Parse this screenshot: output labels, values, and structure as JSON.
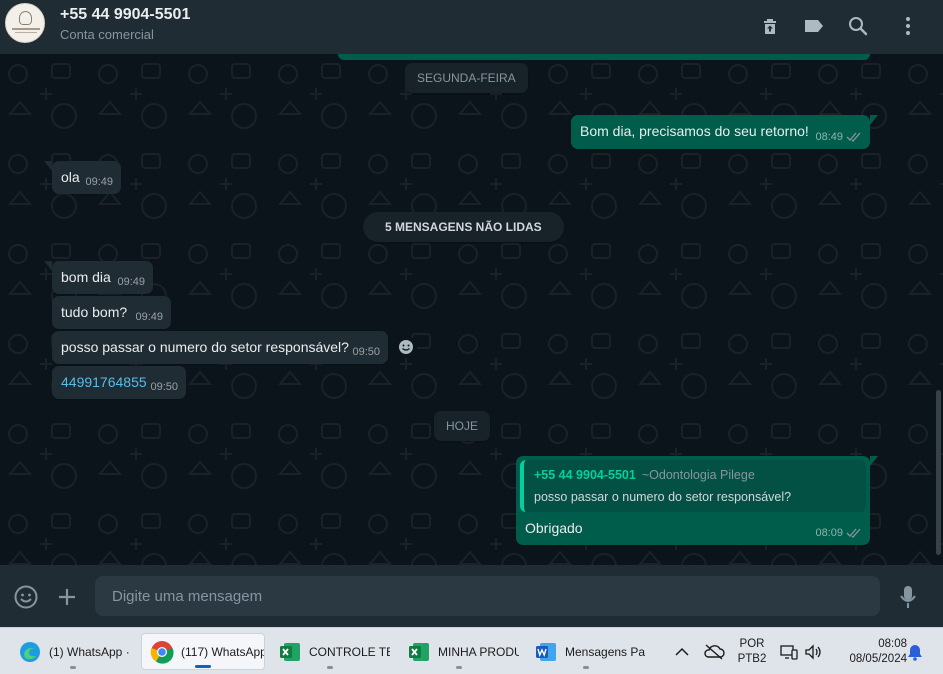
{
  "header": {
    "contact_name": "+55 44 9904-5501",
    "contact_subtitle": "Conta comercial"
  },
  "chat": {
    "date_divider_1": "SEGUNDA-FEIRA",
    "date_divider_2": "HOJE",
    "unread_divider": "5 MENSAGENS NÃO LIDAS",
    "messages": [
      {
        "direction": "out",
        "text": "Bom dia, precisamos do seu retorno!",
        "time": "08:49",
        "status": "read"
      },
      {
        "direction": "in",
        "text": "ola",
        "time": "09:49"
      },
      {
        "direction": "in",
        "text": "bom dia",
        "time": "09:49"
      },
      {
        "direction": "in",
        "text": "tudo bom?",
        "time": "09:49"
      },
      {
        "direction": "in",
        "text": "posso passar o numero do setor responsável?",
        "time": "09:50"
      },
      {
        "direction": "in",
        "text": "44991764855",
        "time": "09:50",
        "is_link": true
      },
      {
        "direction": "out",
        "text": "Obrigado",
        "time": "08:09",
        "status": "read",
        "quote": {
          "author": "+55 44 9904-5501",
          "alias": "~Odontologia Pilege",
          "text": "posso passar o numero do setor responsável?"
        }
      }
    ]
  },
  "composer": {
    "placeholder": "Digite uma mensagem"
  },
  "taskbar": {
    "apps": [
      {
        "label": "(1) WhatsApp ·",
        "icon": "edge-icon"
      },
      {
        "label": "(117) WhatsApp",
        "icon": "chrome-icon",
        "active": true
      },
      {
        "label": "CONTROLE TE",
        "icon": "excel-icon"
      },
      {
        "label": "MINHA PRODU",
        "icon": "excel-icon"
      },
      {
        "label": "Mensagens Pa",
        "icon": "word-icon"
      }
    ],
    "language_line1": "POR",
    "language_line2": "PTB2",
    "clock_time": "08:08",
    "clock_date": "08/05/2024"
  },
  "colors": {
    "app_bg": "#0b141a",
    "panel": "#202c33",
    "incoming_bubble": "#202c33",
    "outgoing_bubble": "#005c4b",
    "accent": "#06cf9c",
    "link": "#53bdeb"
  }
}
